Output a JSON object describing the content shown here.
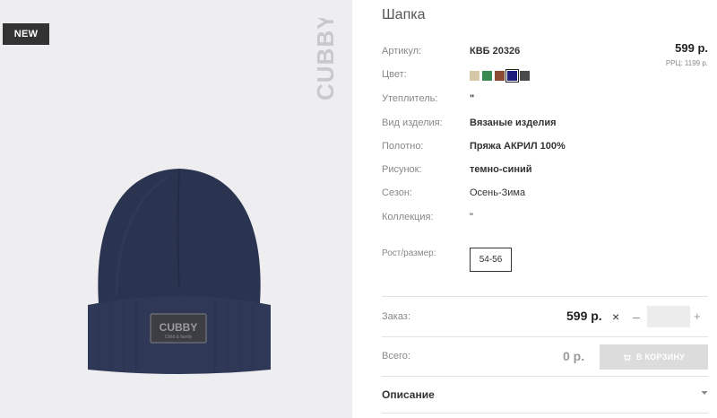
{
  "image": {
    "badge": "NEW",
    "watermark": "CUBBY",
    "patch_brand": "CUBBY",
    "patch_tagline": "Сhild & family"
  },
  "product": {
    "title": "Шапка",
    "price": "599 р.",
    "rrp_label": "РРЦ:",
    "rrp_value": "1199 р."
  },
  "attributes": [
    {
      "label": "Артикул:",
      "value": "КВБ 20326"
    },
    {
      "label": "Цвет:",
      "value": ""
    },
    {
      "label": "Утеплитель:",
      "value": "\""
    },
    {
      "label": "Вид изделия:",
      "value": "Вязаные изделия"
    },
    {
      "label": "Полотно:",
      "value": "Пряжа АКРИЛ 100%"
    },
    {
      "label": "Рисунок:",
      "value": "темно-синий"
    },
    {
      "label": "Сезон:",
      "value": "Осень-Зима"
    },
    {
      "label": "Коллекция:",
      "value": "\""
    },
    {
      "label": "Рост/размер:",
      "value": ""
    }
  ],
  "colors": [
    "#d6c7a6",
    "#3a8a53",
    "#8a4a33",
    "#1e1f7a",
    "#4a4a4a"
  ],
  "selected_color_index": 3,
  "size": "54-56",
  "order": {
    "label": "Заказ:",
    "price": "599 р.",
    "times": "×",
    "minus": "–",
    "quantity": "",
    "plus": "+"
  },
  "total": {
    "label": "Всего:",
    "value": "0 р.",
    "cart_button": "В КОРЗИНУ"
  },
  "description": {
    "title": "Описание"
  }
}
